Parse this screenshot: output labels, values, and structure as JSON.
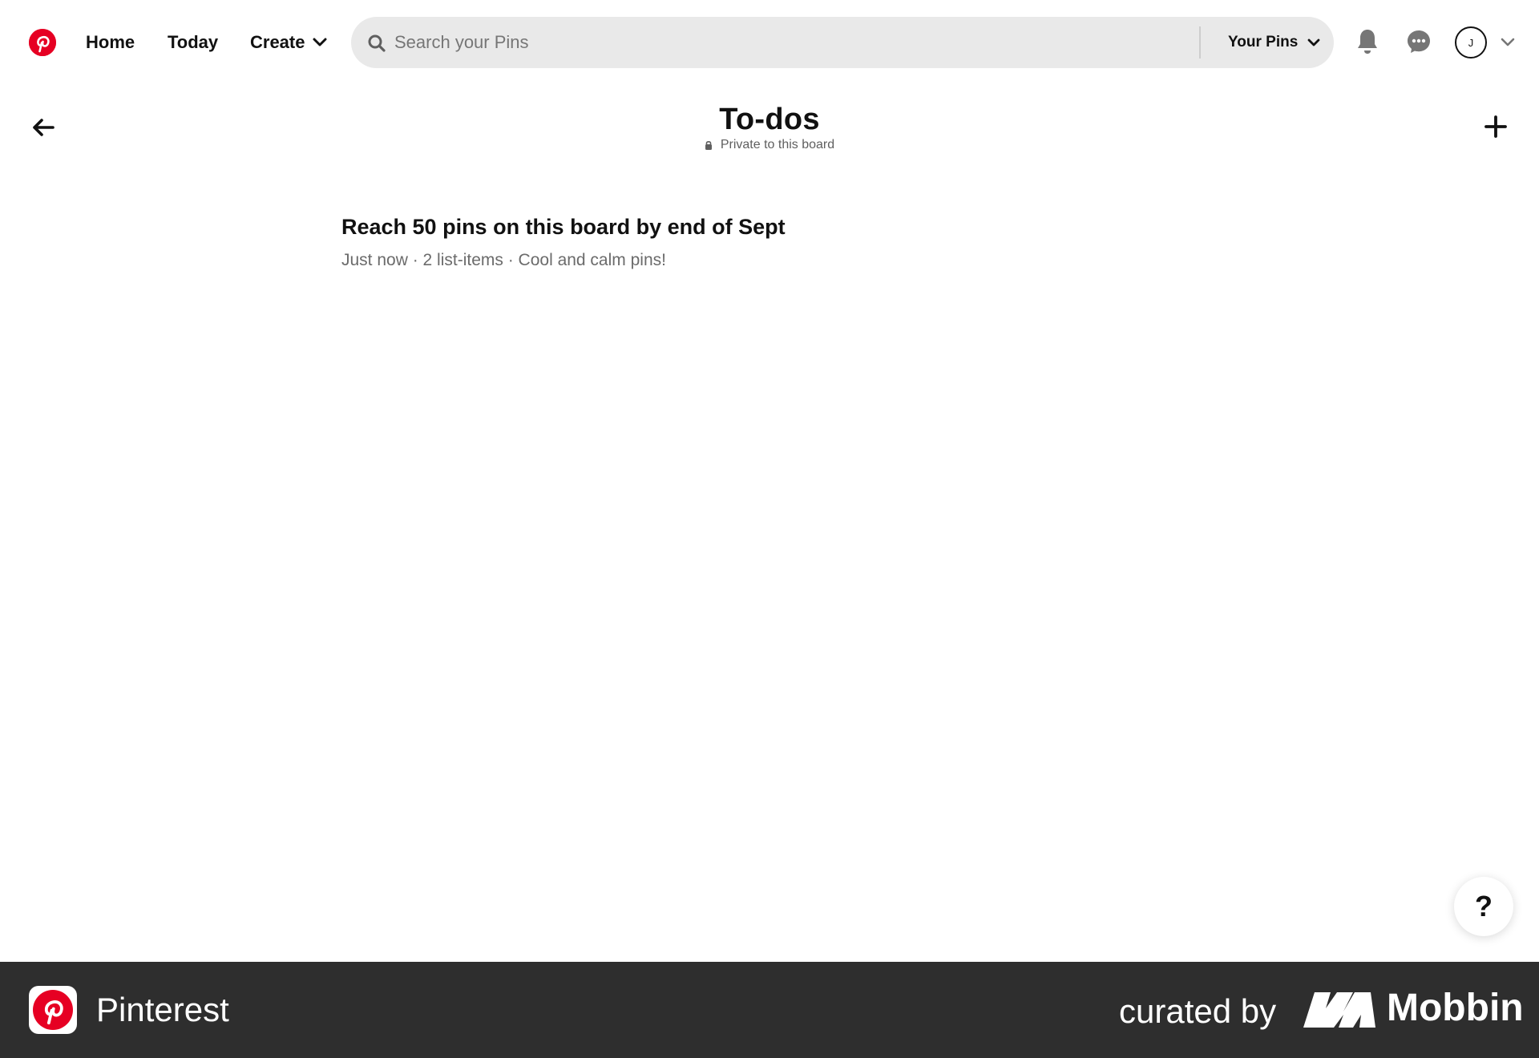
{
  "brand": {
    "accent": "#e60023",
    "logo_letter": "P"
  },
  "nav": {
    "home_label": "Home",
    "today_label": "Today",
    "create_label": "Create"
  },
  "search": {
    "placeholder": "Search your Pins",
    "value": "",
    "scope_label": "Your Pins"
  },
  "account": {
    "avatar_initial": "J"
  },
  "board": {
    "title": "To-dos",
    "privacy_label": "Private to this board"
  },
  "notes": [
    {
      "title": "Reach 50 pins on this board by end of Sept",
      "meta": "Just now · 2 list-items · Cool and calm pins!"
    }
  ],
  "help": {
    "label": "?"
  },
  "footer": {
    "app_name": "Pinterest",
    "curated_by": "curated by",
    "mobbin_label": "Mobbin",
    "background": "#2e2e2e"
  }
}
